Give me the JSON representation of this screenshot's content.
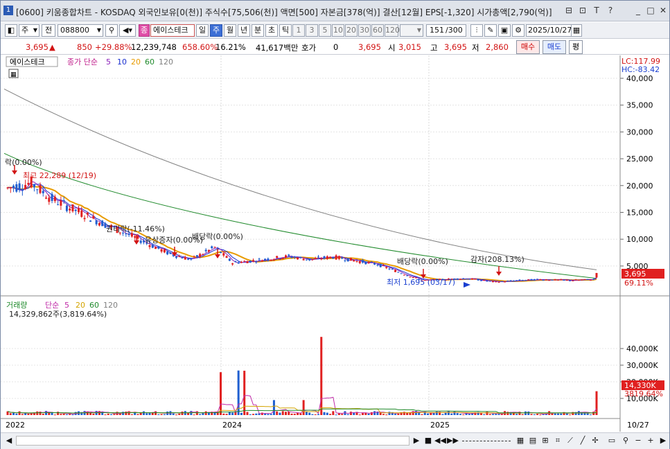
{
  "window": {
    "number": "1",
    "title": "[0600] 키움종합차트 - KOSDAQ 외국인보유[0(천)] 주식수[75,506(천)] 액면[500] 자본금[378(억)] 결산[12월] EPS[-1,320] 시가총액[2,790(억)]",
    "buttons": [
      "⊟",
      "⊡",
      "T",
      "?",
      "_",
      "□",
      "✕"
    ]
  },
  "toolbar": {
    "period_type": "주",
    "market": "전",
    "code": "088800",
    "name_badge": "종",
    "stock_name": "에이스테크",
    "periods": [
      "일",
      "주",
      "월",
      "년",
      "분",
      "초",
      "틱"
    ],
    "selected_period": "주",
    "minutes": [
      "1",
      "3",
      "5",
      "10",
      "20",
      "30",
      "60",
      "120"
    ],
    "count": "151",
    "count_total": "/300",
    "date": "2025/10/27"
  },
  "quote": {
    "price": "3,695",
    "arrow": "▲",
    "change": "850",
    "change_pct": "+29.88%",
    "volume": "12,239,748",
    "vol_ratio": "658.60%",
    "turnover": "16.21%",
    "amount": "41,617백만",
    "hoga_label": "호가",
    "hoga_value": "0",
    "hoga_price": "3,695",
    "open_label": "시",
    "open": "3,015",
    "high_label": "고",
    "high": "3,695",
    "low_label": "저",
    "low": "2,860",
    "buy": "매수",
    "sell": "매도",
    "eval": "평"
  },
  "price_panel": {
    "legend_name": "에이스테크",
    "legend_ma": "종가 단순",
    "ma_periods": [
      "5",
      "10",
      "20",
      "60",
      "120"
    ],
    "ma_colors": [
      "#8a1fb8",
      "#1a2fd0",
      "#e89b00",
      "#1f8a2b",
      "#808080"
    ],
    "lc": "LC:117.99",
    "hc": "HC:-83.42",
    "y_ticks": [
      "40,000",
      "35,000",
      "30,000",
      "25,000",
      "20,000",
      "15,000",
      "10,000",
      "5,000"
    ],
    "last_price": "3,695",
    "last_pct": "69.11%",
    "annotations": {
      "top_left": "락(0.00%)",
      "high": "최고 22,289 (12/19)",
      "rights1": "권리락(-11.46%)",
      "rights2": "유상증자(0.00%)",
      "dividend1": "배당락(0.00%)",
      "dividend2": "배당락(0.00%)",
      "capital_reduction": "감자(208.13%)",
      "low": "최저 1,695 (03/17)"
    }
  },
  "volume_panel": {
    "legend_name": "거래량",
    "legend_ma": "단순",
    "ma_periods": [
      "5",
      "20",
      "60",
      "120"
    ],
    "ma_colors": [
      "#c02ba8",
      "#d4a400",
      "#1f8a2b",
      "#808080"
    ],
    "info": "14,329,862주(3,819.64%)",
    "y_ticks": [
      "40,000K",
      "30,000K",
      "20,000K",
      "10,000K"
    ],
    "last_volume": "14,330K",
    "last_pct": "3819.64%"
  },
  "x_axis": {
    "labels": [
      "2022",
      "2024",
      "2025"
    ],
    "right_label": "10/27"
  },
  "colors": {
    "up": "#e02020",
    "down": "#1f5fd0",
    "ma5": "#8a1fb8",
    "ma10": "#1a2fd0",
    "ma20": "#e89b00",
    "ma60": "#1f8a2b",
    "ma120": "#808080"
  }
}
